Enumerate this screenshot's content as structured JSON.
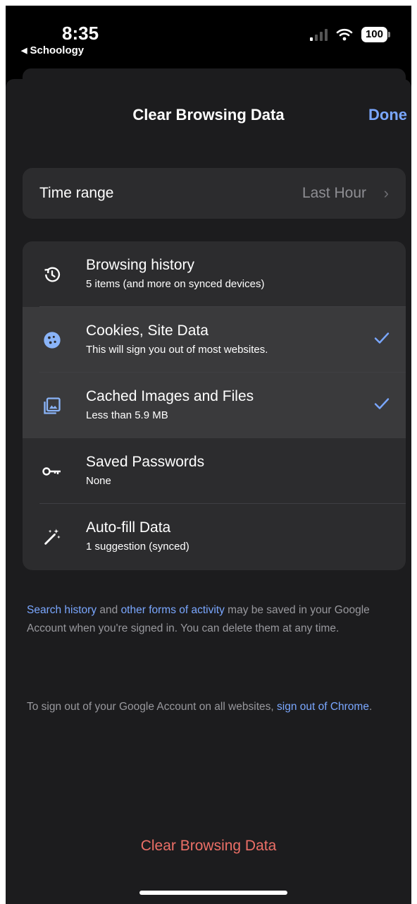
{
  "status_bar": {
    "time": "8:35",
    "back_app": "Schoology",
    "battery": "100"
  },
  "sheet": {
    "title": "Clear Browsing Data",
    "done_label": "Done"
  },
  "time_range": {
    "label": "Time range",
    "value": "Last Hour"
  },
  "items": [
    {
      "title": "Browsing history",
      "subtitle": "5 items (and more on synced devices)",
      "icon": "history-icon",
      "checked": false
    },
    {
      "title": "Cookies, Site Data",
      "subtitle": "This will sign you out of most websites.",
      "icon": "cookie-icon",
      "checked": true
    },
    {
      "title": "Cached Images and Files",
      "subtitle": "Less than 5.9 MB",
      "icon": "image-cache-icon",
      "checked": true
    },
    {
      "title": "Saved Passwords",
      "subtitle": "None",
      "icon": "key-icon",
      "checked": false
    },
    {
      "title": "Auto-fill Data",
      "subtitle": "1 suggestion (synced)",
      "icon": "magic-wand-icon",
      "checked": false
    }
  ],
  "footnote1": {
    "link1": "Search history",
    "t1": " and ",
    "link2": "other forms of activity",
    "t2": " may be saved in your Google Account when you're signed in. You can delete them at any time."
  },
  "footnote2": {
    "t1": "To sign out of your Google Account on all websites, ",
    "link": "sign out of Chrome",
    "t2": "."
  },
  "clear_button": "Clear Browsing Data",
  "colors": {
    "accent": "#7aa7ff",
    "destructive": "#ec6f67",
    "sheet_bg": "#1c1c1e",
    "card_bg": "#2c2c2e"
  }
}
